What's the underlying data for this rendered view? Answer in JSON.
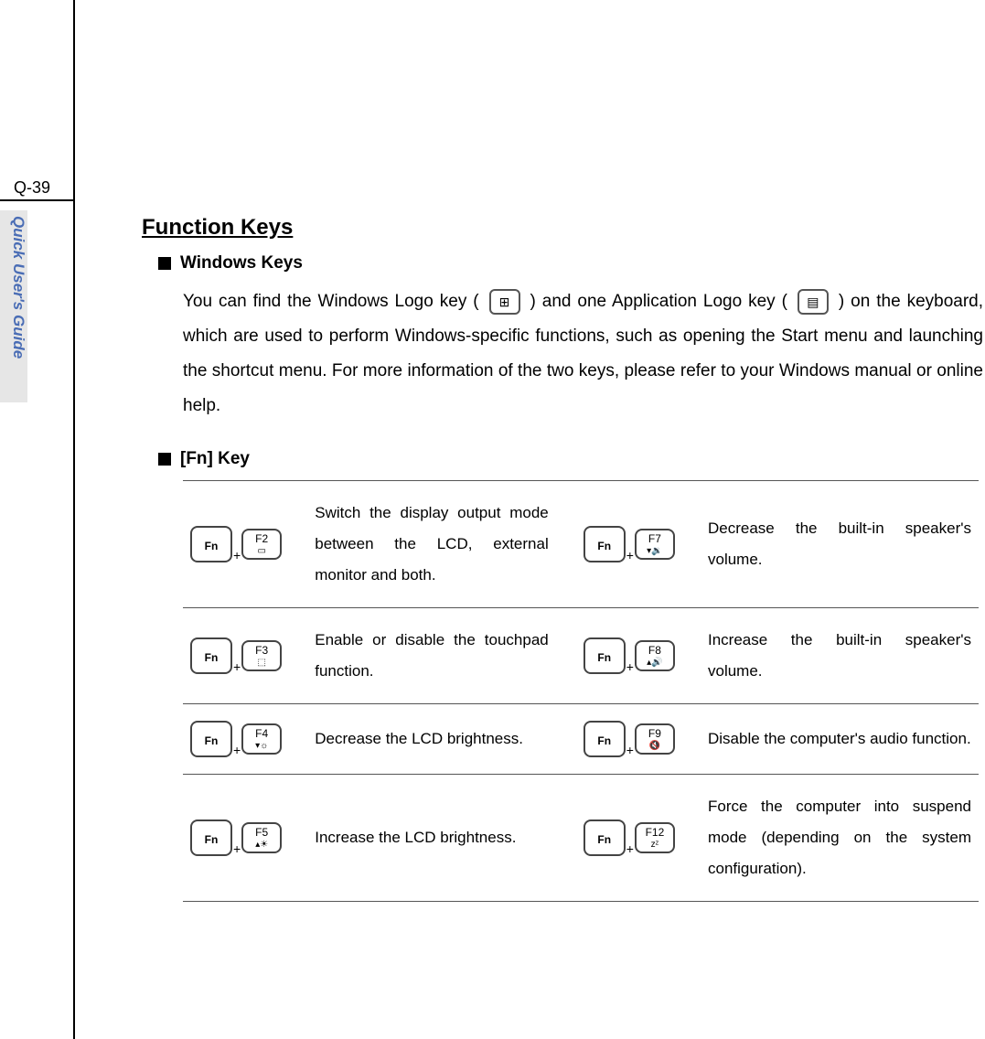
{
  "page_number": "Q-39",
  "tab_label": "Quick User's Guide",
  "heading": "Function Keys",
  "sections": {
    "windows": {
      "title": "Windows Keys",
      "para_a": "You can find the Windows Logo key (",
      "para_b": ") and one Application Logo key (",
      "para_c": ") on the keyboard, which are used to perform Windows-specific functions, such as opening the Start menu and launching the shortcut menu.   For more information of the two keys, please refer to your Windows manual or online help."
    },
    "fn": {
      "title": "[Fn] Key",
      "rows": [
        {
          "left_key": "F2",
          "left_icon": "▭",
          "left_desc": "Switch the display output mode between the LCD, external monitor and both.",
          "right_key": "F7",
          "right_icon": "▾🔉",
          "right_desc": "Decrease the built-in speaker's volume."
        },
        {
          "left_key": "F3",
          "left_icon": "⬚",
          "left_desc": "Enable or disable the touchpad function.",
          "right_key": "F8",
          "right_icon": "▴🔊",
          "right_desc": "Increase the built-in speaker's volume."
        },
        {
          "left_key": "F4",
          "left_icon": "▾☼",
          "left_desc": "Decrease the LCD brightness.",
          "right_key": "F9",
          "right_icon": "🔇",
          "right_desc": "Disable the computer's audio function."
        },
        {
          "left_key": "F5",
          "left_icon": "▴☀",
          "left_desc": "Increase the LCD brightness.",
          "right_key": "F12",
          "right_icon": "zᶻ",
          "right_desc": "Force the computer into suspend mode (depending on the system configuration)."
        }
      ]
    }
  },
  "key_labels": {
    "fn": "Fn",
    "plus": "+"
  },
  "icons": {
    "windows": "⊞",
    "menu": "▤"
  }
}
